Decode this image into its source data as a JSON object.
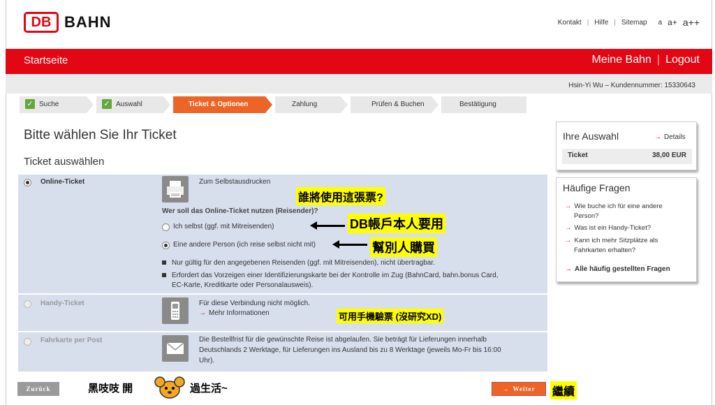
{
  "header": {
    "logo_db": "DB",
    "logo_bahn": "BAHN",
    "links": [
      "Kontakt",
      "Hilfe",
      "Sitemap"
    ],
    "font_sizes": [
      "a",
      "a+",
      "a++"
    ]
  },
  "nav": {
    "startseite": "Startseite",
    "meine_bahn": "Meine Bahn",
    "logout": "Logout"
  },
  "user_info": "Hsin-Yi Wu – Kundennummer: 15330643",
  "steps": [
    {
      "label": "Suche",
      "done": true
    },
    {
      "label": "Auswahl",
      "done": true
    },
    {
      "label": "Ticket & Optionen",
      "active": true
    },
    {
      "label": "Zahlung"
    },
    {
      "label": "Prüfen & Buchen"
    },
    {
      "label": "Bestätigung"
    }
  ],
  "main": {
    "title": "Bitte wählen Sie Ihr Ticket",
    "subtitle": "Ticket auswählen",
    "online": {
      "label": "Online-Ticket",
      "desc": "Zum Selbstausdrucken",
      "question": "Wer soll das Online-Ticket nutzen (Reisender)?",
      "option1": "Ich selbst (ggf. mit Mitreisenden)",
      "option2": "Eine andere Person (ich reise selbst nicht mit)",
      "note1": "Nur gültig für den angegebenen Reisenden (ggf. mit Mitreisenden), nicht übertragbar.",
      "note2_line1": "Erfordert das Vorzeigen einer Identifizierungskarte bei der Kontrolle im Zug (BahnCard, bahn.bonus Card,",
      "note2_line2": "EC-Karte, Kreditkarte oder Personalausweis)."
    },
    "handy": {
      "label": "Handy-Ticket",
      "desc": "Für diese Verbindung nicht möglich.",
      "link": "Mehr Informationen"
    },
    "post": {
      "label": "Fahrkarte per Post",
      "line1": "Die Bestellfrist für die gewünschte Reise ist abgelaufen. Sie beträgt für Lieferungen innerhalb",
      "line2": "Deutschlands 2 Werktage, für Lieferungen ins Ausland bis zu 8 Werktage (jeweils Mo-Fr bis 16:00",
      "line3": "Uhr)."
    }
  },
  "sidebar": {
    "auswahl_title": "Ihre Auswahl",
    "details": "Details",
    "ticket_label": "Ticket",
    "ticket_price": "38,00 EUR",
    "faq_title": "Häufige Fragen",
    "faq1_l1": "Wie buche ich für eine andere",
    "faq1_l2": "Person?",
    "faq2": "Was ist ein Handy-Ticket?",
    "faq3_l1": "Kann ich mehr Sitzplätze als",
    "faq3_l2": "Fahrkarten erhalten?",
    "faq_all": "Alle häufig gestellten Fragen"
  },
  "buttons": {
    "back": "Zurück",
    "next": "Weiter"
  },
  "annotations": {
    "who": "誰將使用這張票?",
    "self": "DB帳戶本人要用",
    "other": "幫別人購買",
    "mobile": "可用手機驗票 (沒研究XD)",
    "footer_left": "黑吱吱 開",
    "footer_right": "過生活~",
    "continue": "繼續"
  },
  "colors": {
    "db_red": "#e30613",
    "step_active": "#ec6526",
    "panel_bg": "#d7deec",
    "highlight": "#ffff00"
  }
}
